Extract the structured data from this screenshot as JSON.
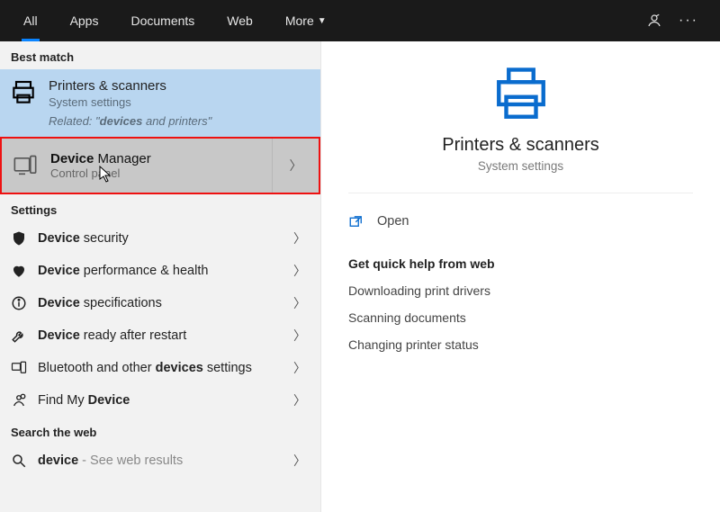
{
  "header": {
    "tabs": [
      "All",
      "Apps",
      "Documents",
      "Web",
      "More"
    ],
    "active_tab_index": 0
  },
  "left": {
    "best_match_label": "Best match",
    "best_match": {
      "title": "Printers & scanners",
      "subtitle": "System settings",
      "related_prefix": "Related: \"",
      "related_emph": "devices",
      "related_suffix": " and printers\""
    },
    "device_manager": {
      "title_emph": "Device",
      "title_rest": " Manager",
      "subtitle": "Control panel"
    },
    "settings_label": "Settings",
    "settings": [
      {
        "pre": "",
        "emph": "Device",
        "post": " security",
        "icon": "shield"
      },
      {
        "pre": "",
        "emph": "Device",
        "post": " performance & health",
        "icon": "heart"
      },
      {
        "pre": "",
        "emph": "Device",
        "post": " specifications",
        "icon": "info"
      },
      {
        "pre": "",
        "emph": "Device",
        "post": " ready after restart",
        "icon": "wrench"
      },
      {
        "pre": "Bluetooth and other ",
        "emph": "devices",
        "post": " settings",
        "icon": "devices"
      },
      {
        "pre": "Find My ",
        "emph": "Device",
        "post": "",
        "icon": "person-pin"
      }
    ],
    "search_label": "Search the web",
    "search": {
      "emph": "device",
      "tail": " - See web results"
    }
  },
  "right": {
    "title": "Printers & scanners",
    "subtitle": "System settings",
    "open_label": "Open",
    "quick_title": "Get quick help from web",
    "quick_links": [
      "Downloading print drivers",
      "Scanning documents",
      "Changing printer status"
    ]
  }
}
